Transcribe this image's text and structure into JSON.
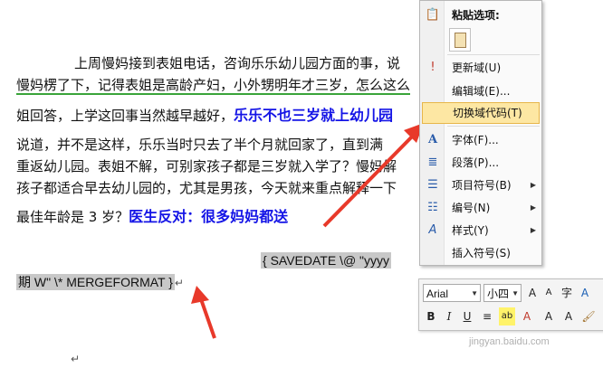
{
  "document": {
    "lines": [
      "上周慢妈接到表姐电话，咨询乐乐幼儿园方面的事，说",
      "慢妈楞了下，记得表姐是高龄产妇，小外甥明年才三岁，怎么这么",
      "姐回答，上学这回事当然越早越好，",
      "说道，并不是这样，乐乐当时只去了半个月就回家了，直到满",
      "重返幼儿园。表姐不解，可别家孩子都是三岁就入学了？慢妈解",
      "孩子都适合早去幼儿园的，尤其是男孩，今天就来重点解释一下",
      "最佳年龄是 3 岁？"
    ],
    "bold_blue_1": "乐乐不也三岁就上幼儿园",
    "bold_blue_2": "医生反对：很多妈妈都送",
    "field_code_1": "{ SAVEDATE   \\@ \"yyyy",
    "field_code_2": "期 W\"   \\* MERGEFORMAT }",
    "para_mark": "↵"
  },
  "context_menu": {
    "paste_header": "粘贴选项:",
    "items": [
      {
        "label": "更新域(U)",
        "icon": "update-field-icon"
      },
      {
        "label": "编辑域(E)...",
        "icon": ""
      },
      {
        "label": "切换域代码(T)",
        "icon": "",
        "highlighted": true
      },
      {
        "label": "字体(F)...",
        "icon": "font-icon"
      },
      {
        "label": "段落(P)...",
        "icon": "paragraph-icon"
      },
      {
        "label": "项目符号(B)",
        "icon": "bullets-icon",
        "submenu": true
      },
      {
        "label": "编号(N)",
        "icon": "numbering-icon",
        "submenu": true
      },
      {
        "label": "样式(Y)",
        "icon": "styles-icon",
        "submenu": true
      },
      {
        "label": "插入符号(S)",
        "icon": ""
      }
    ]
  },
  "mini_toolbar": {
    "font_name": "Arial",
    "font_size": "小四",
    "row1_buttons": [
      "A",
      "A",
      "字",
      "A"
    ],
    "row2_buttons": [
      "B",
      "I",
      "U",
      "≡",
      "ab",
      "A",
      "A",
      "A"
    ]
  },
  "watermark": "jingyan.baidu.com",
  "colors": {
    "highlight": "#fde7a3",
    "field_bg": "#c8c8c8",
    "accent_blue": "#1414e6",
    "arrow_red": "#e8392a"
  }
}
